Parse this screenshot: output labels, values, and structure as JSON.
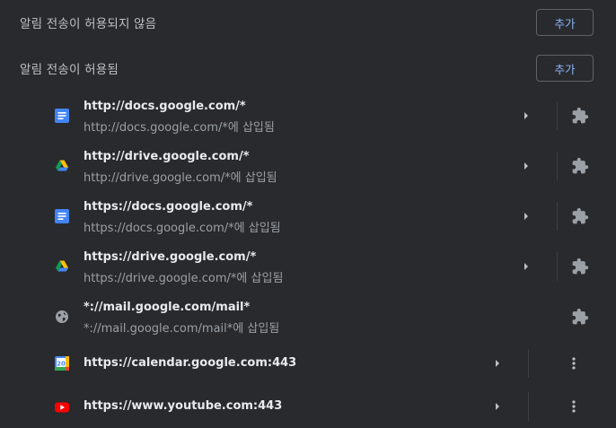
{
  "blocked": {
    "title": "알림 전송이 허용되지 않음",
    "add_label": "추가"
  },
  "allowed": {
    "title": "알림 전송이 허용됨",
    "add_label": "추가"
  },
  "sites": [
    {
      "title": "http://docs.google.com/*",
      "subtitle": "http://docs.google.com/*에 삽입됨",
      "icon": "google-docs-icon"
    },
    {
      "title": "http://drive.google.com/*",
      "subtitle": "http://drive.google.com/*에 삽입됨",
      "icon": "google-drive-icon"
    },
    {
      "title": "https://docs.google.com/*",
      "subtitle": "https://docs.google.com/*에 삽입됨",
      "icon": "google-docs-icon"
    },
    {
      "title": "https://drive.google.com/*",
      "subtitle": "https://drive.google.com/*에 삽입됨",
      "icon": "google-drive-icon"
    },
    {
      "title": "*://mail.google.com/mail*",
      "subtitle": "*://mail.google.com/mail*에 삽입됨",
      "icon": "globe-icon"
    },
    {
      "title": "https://calendar.google.com:443",
      "icon": "google-calendar-icon"
    },
    {
      "title": "https://www.youtube.com:443",
      "icon": "youtube-icon"
    }
  ],
  "calendar_icon_day": "20",
  "colors": {
    "background": "#292a2d",
    "accent": "#8ab4f8",
    "secondary_text": "#9aa0a6"
  }
}
